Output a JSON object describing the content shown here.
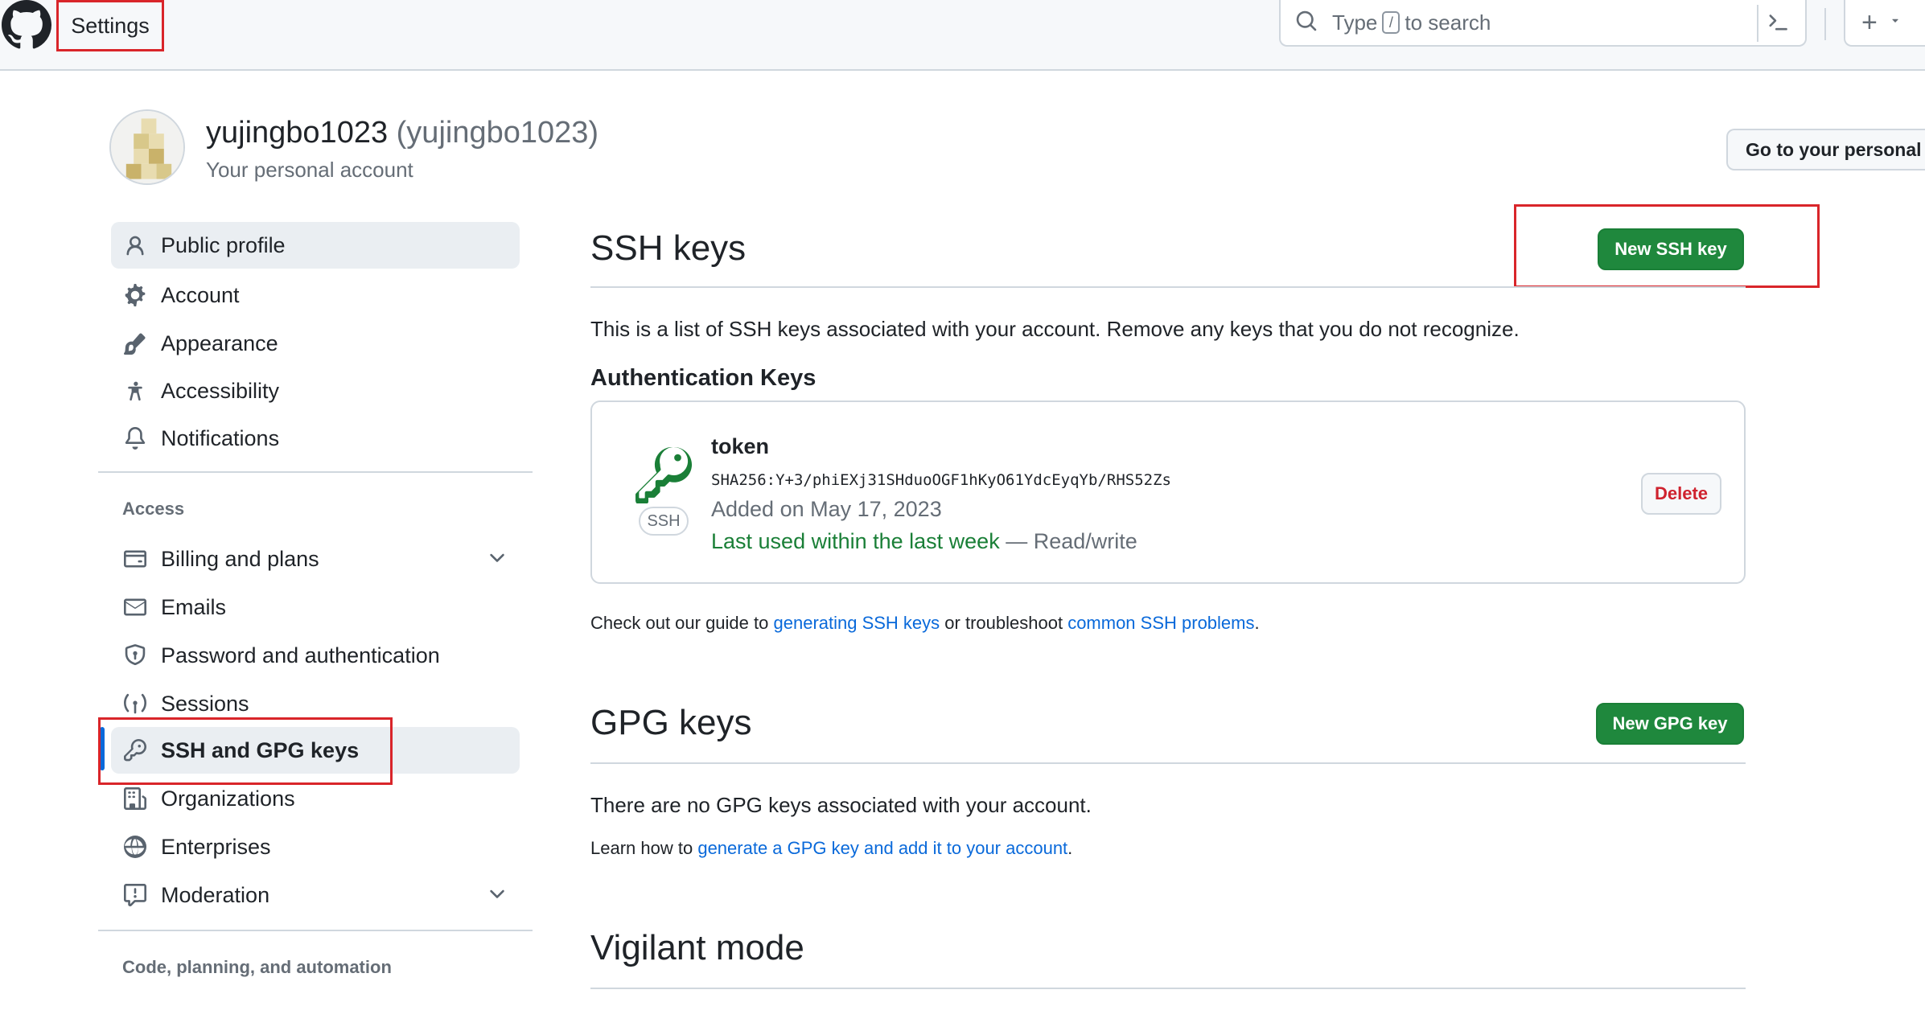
{
  "header": {
    "title": "Settings",
    "search_prefix": "Type",
    "search_key": "/",
    "search_suffix": "to search",
    "plus_label": "+"
  },
  "profile": {
    "name": "yujingbo1023",
    "handle": "(yujingbo1023)",
    "subtitle": "Your personal account",
    "go_button": "Go to your personal profile"
  },
  "sidebar": {
    "items": [
      {
        "label": "Public profile",
        "icon": "person-icon"
      },
      {
        "label": "Account",
        "icon": "gear-icon"
      },
      {
        "label": "Appearance",
        "icon": "paintbrush-icon"
      },
      {
        "label": "Accessibility",
        "icon": "accessibility-icon"
      },
      {
        "label": "Notifications",
        "icon": "bell-icon"
      }
    ],
    "access_heading": "Access",
    "access_items": [
      {
        "label": "Billing and plans",
        "icon": "credit-card-icon"
      },
      {
        "label": "Emails",
        "icon": "mail-icon"
      },
      {
        "label": "Password and authentication",
        "icon": "shield-icon"
      },
      {
        "label": "Sessions",
        "icon": "broadcast-icon"
      },
      {
        "label": "SSH and GPG keys",
        "icon": "key-icon"
      },
      {
        "label": "Organizations",
        "icon": "organization-icon"
      },
      {
        "label": "Enterprises",
        "icon": "globe-icon"
      },
      {
        "label": "Moderation",
        "icon": "report-icon"
      }
    ],
    "code_heading": "Code, planning, and automation"
  },
  "ssh": {
    "title": "SSH keys",
    "new_button": "New SSH key",
    "description": "This is a list of SSH keys associated with your account. Remove any keys that you do not recognize.",
    "auth_heading": "Authentication Keys",
    "key": {
      "badge": "SSH",
      "name": "token",
      "fingerprint": "SHA256:Y+3/phiEXj31SHduoOGF1hKyO61YdcEyqYb/RHS52Zs",
      "added": "Added on May 17, 2023",
      "last_used": "Last used within the last week",
      "access": "— Read/write",
      "delete_label": "Delete"
    },
    "guide_prefix": "Check out our guide to",
    "guide_link1": "generating SSH keys",
    "guide_middle": "or troubleshoot",
    "guide_link2": "common SSH problems",
    "guide_end": "."
  },
  "gpg": {
    "title": "GPG keys",
    "new_button": "New GPG key",
    "empty": "There are no GPG keys associated with your account.",
    "learn_prefix": "Learn how to",
    "learn_link": "generate a GPG key and add it to your account",
    "learn_end": "."
  },
  "vigilant": {
    "title": "Vigilant mode"
  },
  "colors": {
    "primary_green": "#1f883d",
    "link_blue": "#0969da",
    "danger_red": "#cf222e",
    "annotation_red": "#d9252a"
  }
}
